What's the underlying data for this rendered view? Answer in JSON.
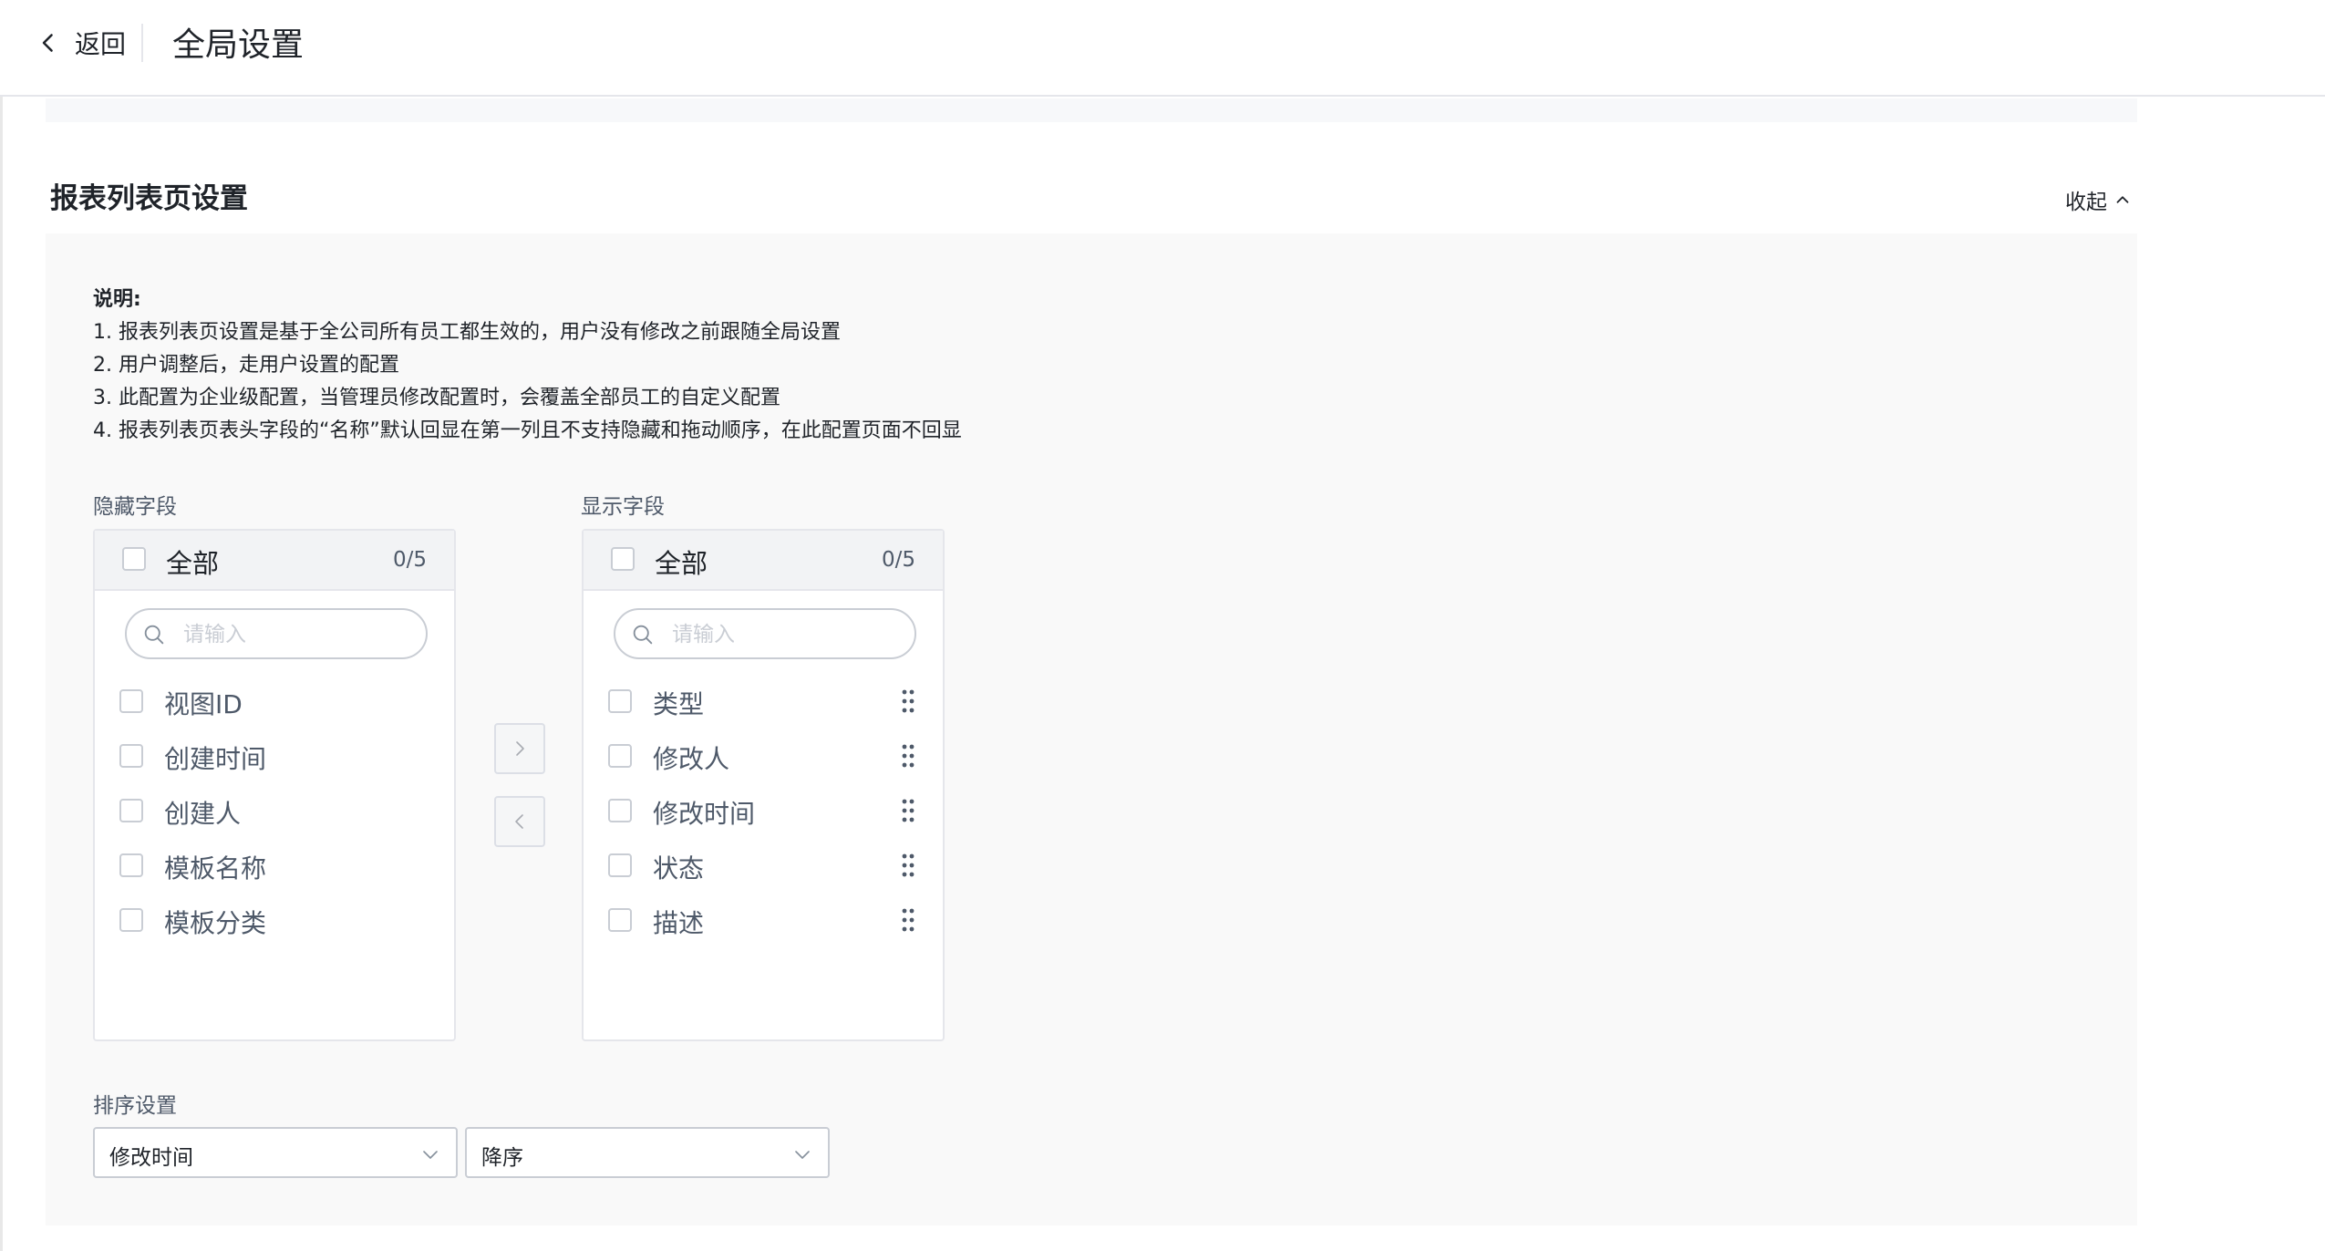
{
  "header": {
    "back_label": "返回",
    "title": "全局设置"
  },
  "section": {
    "title": "报表列表页设置",
    "collapse_label": "收起",
    "description": {
      "title": "说明:",
      "lines": [
        "1. 报表列表页设置是基于全公司所有员工都生效的，用户没有修改之前跟随全局设置",
        "2. 用户调整后，走用户设置的配置",
        "3. 此配置为企业级配置，当管理员修改配置时，会覆盖全部员工的自定义配置",
        "4. 报表列表页表头字段的“名称”默认回显在第一列且不支持隐藏和拖动顺序，在此配置页面不回显"
      ]
    }
  },
  "transfer": {
    "hidden": {
      "label": "隐藏字段",
      "all_label": "全部",
      "count": "0/5",
      "search_placeholder": "请输入",
      "items": [
        "视图ID",
        "创建时间",
        "创建人",
        "模板名称",
        "模板分类"
      ]
    },
    "shown": {
      "label": "显示字段",
      "all_label": "全部",
      "count": "0/5",
      "search_placeholder": "请输入",
      "items": [
        "类型",
        "修改人",
        "修改时间",
        "状态",
        "描述"
      ]
    }
  },
  "sort": {
    "label": "排序设置",
    "field_value": "修改时间",
    "order_value": "降序"
  }
}
